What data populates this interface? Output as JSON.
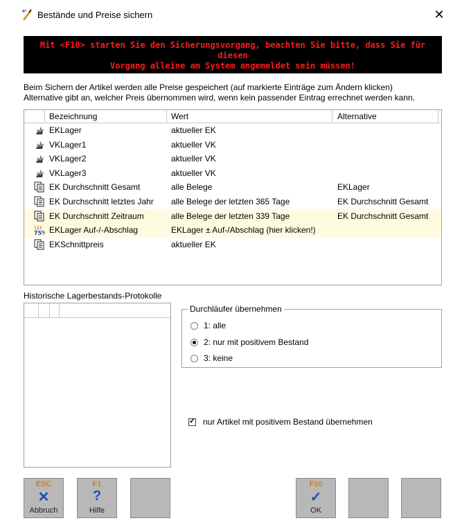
{
  "window": {
    "title": "Bestände und Preise sichern",
    "close_glyph": "✕"
  },
  "warning": {
    "line1": "Mit <F10> starten Sie den Sicherungsvorgang, beachten Sie bitte, dass Sie für diesen",
    "line2": "Vorgang alleine am System angemeldet sein müssen!",
    "color": "#ff1a1a"
  },
  "info": {
    "line1": "Beim Sichern der Artikel werden alle Preise gespeichert (auf markierte Einträge zum Ändern klicken)",
    "line2": "Alternative gibt an, welcher Preis übernommen wird, wenn kein passender Eintrag errechnet werden kann."
  },
  "table": {
    "columns": [
      "Bezeichnung",
      "Wert",
      "Alternative"
    ],
    "rows": [
      {
        "icon": "hand-icon",
        "name": "EKLager",
        "value": "aktueller EK",
        "alt": ""
      },
      {
        "icon": "hand-icon",
        "name": "VKLager1",
        "value": "aktueller VK",
        "alt": ""
      },
      {
        "icon": "hand-icon",
        "name": "VKLager2",
        "value": "aktueller VK",
        "alt": ""
      },
      {
        "icon": "hand-icon",
        "name": "VKLager3",
        "value": "aktueller VK",
        "alt": ""
      },
      {
        "icon": "documents-icon",
        "name": "EK Durchschnitt Gesamt",
        "value": "alle Belege",
        "alt": "EKLager"
      },
      {
        "icon": "documents-icon",
        "name": "EK Durchschnitt letztes Jahr",
        "value": "alle Belege der letzten 365 Tage",
        "alt": "EK Durchschnitt Gesamt"
      },
      {
        "icon": "documents-icon",
        "name": "EK Durchschnitt Zeitraum",
        "value": "alle Belege der letzten 339 Tage",
        "alt": "EK Durchschnitt Gesamt",
        "selected": true
      },
      {
        "icon": "percent-icon",
        "name": "EKLager Auf-/-Abschlag",
        "value": "EKLager ± Auf-/Abschlag (hier klicken!)",
        "alt": "",
        "selected": true
      },
      {
        "icon": "documents-icon",
        "name": "EKSchnittpreis",
        "value": "aktueller EK",
        "alt": ""
      }
    ]
  },
  "history": {
    "label": "Historische Lagerbestands-Protokolle"
  },
  "durchlaeufer": {
    "legend": "Durchläufer übernehmen",
    "options": [
      {
        "label": "1: alle",
        "checked": false
      },
      {
        "label": "2: nur mit positivem Bestand",
        "checked": true
      },
      {
        "label": "3: keine",
        "checked": false
      }
    ]
  },
  "checkbox": {
    "label": "nur Artikel mit positivem Bestand übernehmen",
    "checked": true
  },
  "buttons": {
    "esc": {
      "key": "ESC",
      "symbol": "✕",
      "label": "Abbruch"
    },
    "f1": {
      "key": "F1",
      "symbol": "?",
      "label": "Hilfe"
    },
    "f10": {
      "key": "F10",
      "symbol": "✓",
      "label": "OK"
    }
  }
}
